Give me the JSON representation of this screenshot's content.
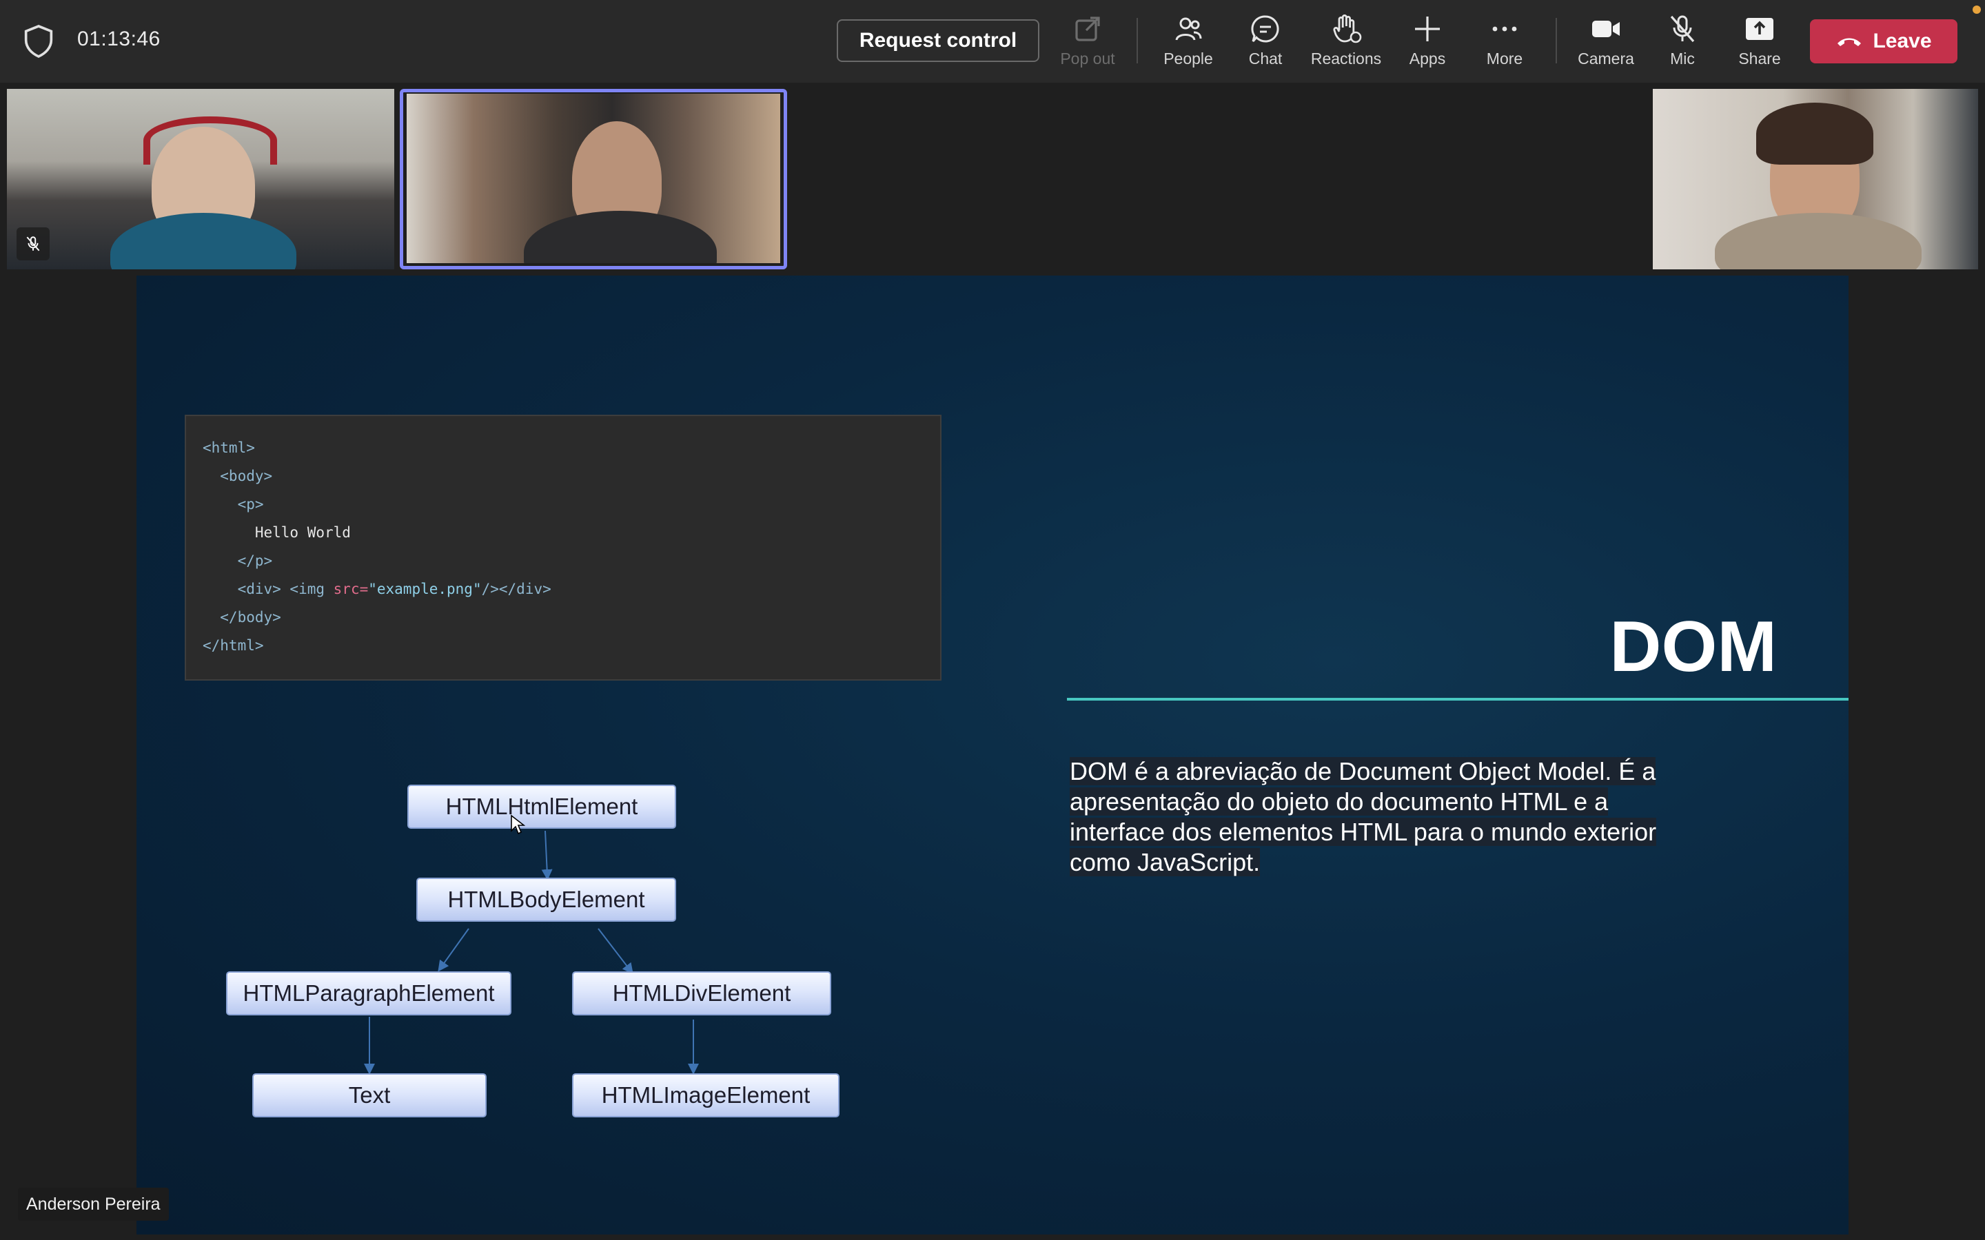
{
  "meeting": {
    "timer": "01:13:46",
    "request_control": "Request control",
    "toolbar": {
      "popout": "Pop out",
      "people": "People",
      "chat": "Chat",
      "reactions": "Reactions",
      "apps": "Apps",
      "more": "More",
      "camera": "Camera",
      "mic": "Mic",
      "share": "Share",
      "leave": "Leave"
    },
    "leave_color": "#c4314b",
    "active_speaker_border": "#7f85f5"
  },
  "slide": {
    "code_lines": [
      {
        "parts": [
          {
            "t": "<html>",
            "c": "tag"
          }
        ]
      },
      {
        "parts": [
          {
            "t": "  <body>",
            "c": "tag"
          }
        ]
      },
      {
        "parts": [
          {
            "t": "    <p>",
            "c": "tag"
          }
        ]
      },
      {
        "parts": [
          {
            "t": "      Hello World",
            "c": "txt"
          }
        ]
      },
      {
        "parts": [
          {
            "t": "    </p>",
            "c": "tag"
          }
        ]
      },
      {
        "parts": [
          {
            "t": "    <div> <img ",
            "c": "tag"
          },
          {
            "t": "src=",
            "c": "attr"
          },
          {
            "t": "\"example.png\"",
            "c": "str"
          },
          {
            "t": "/></div>",
            "c": "tag"
          }
        ]
      },
      {
        "parts": [
          {
            "t": "  </body>",
            "c": "tag"
          }
        ]
      },
      {
        "parts": [
          {
            "t": "</html>",
            "c": "tag"
          }
        ]
      }
    ],
    "tree": {
      "html": "HTMLHtmlElement",
      "body": "HTMLBodyElement",
      "paragraph": "HTMLParagraphElement",
      "div": "HTMLDivElement",
      "text": "Text",
      "image": "HTMLImageElement"
    },
    "title": "DOM",
    "description": "DOM é a abreviação de Document Object Model. É a apresentação do objeto do documento HTML e a interface dos elementos HTML para o mundo exterior como JavaScript.",
    "accent": "#48c7c0"
  },
  "presenter_name": "Anderson Pereira"
}
